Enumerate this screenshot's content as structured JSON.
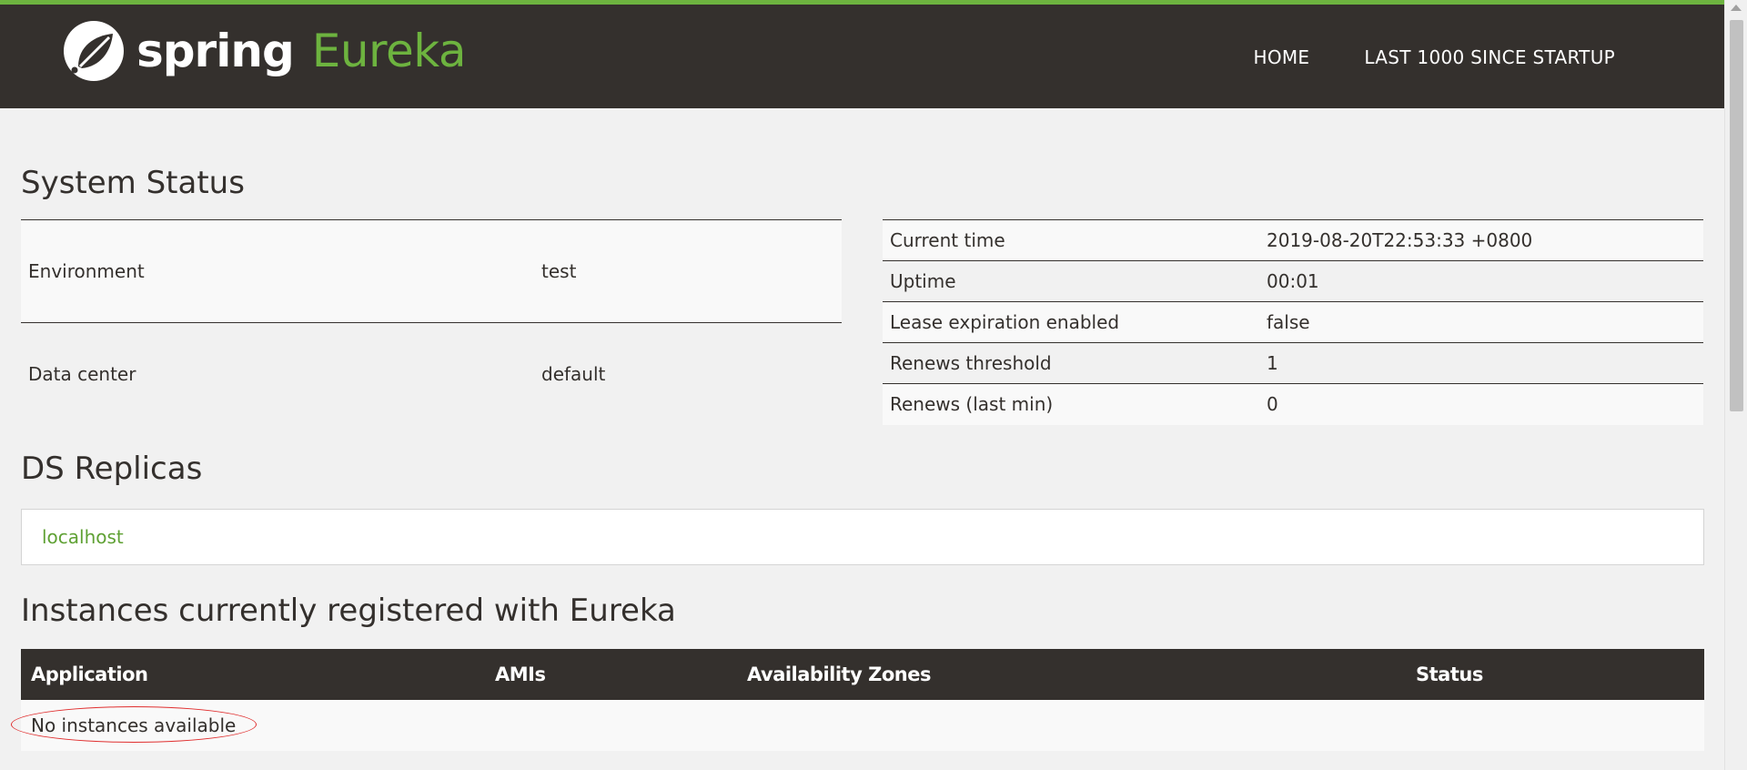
{
  "header": {
    "brand_spring": "spring",
    "brand_eureka": "Eureka",
    "logo_icon": "spring-leaf-icon",
    "nav": [
      {
        "label": "HOME"
      },
      {
        "label": "LAST 1000 SINCE STARTUP"
      }
    ],
    "colors": {
      "accent": "#6db33f",
      "bar": "#34302d"
    }
  },
  "system_status": {
    "title": "System Status",
    "left": [
      {
        "key": "Environment",
        "value": "test"
      },
      {
        "key": "Data center",
        "value": "default"
      }
    ],
    "right": [
      {
        "key": "Current time",
        "value": "2019-08-20T22:53:33 +0800"
      },
      {
        "key": "Uptime",
        "value": "00:01"
      },
      {
        "key": "Lease expiration enabled",
        "value": "false"
      },
      {
        "key": "Renews threshold",
        "value": "1"
      },
      {
        "key": "Renews (last min)",
        "value": "0"
      }
    ]
  },
  "replicas": {
    "title": "DS Replicas",
    "items": [
      "localhost"
    ]
  },
  "instances": {
    "title": "Instances currently registered with Eureka",
    "columns": [
      "Application",
      "AMIs",
      "Availability Zones",
      "Status"
    ],
    "empty_text": "No instances available"
  }
}
